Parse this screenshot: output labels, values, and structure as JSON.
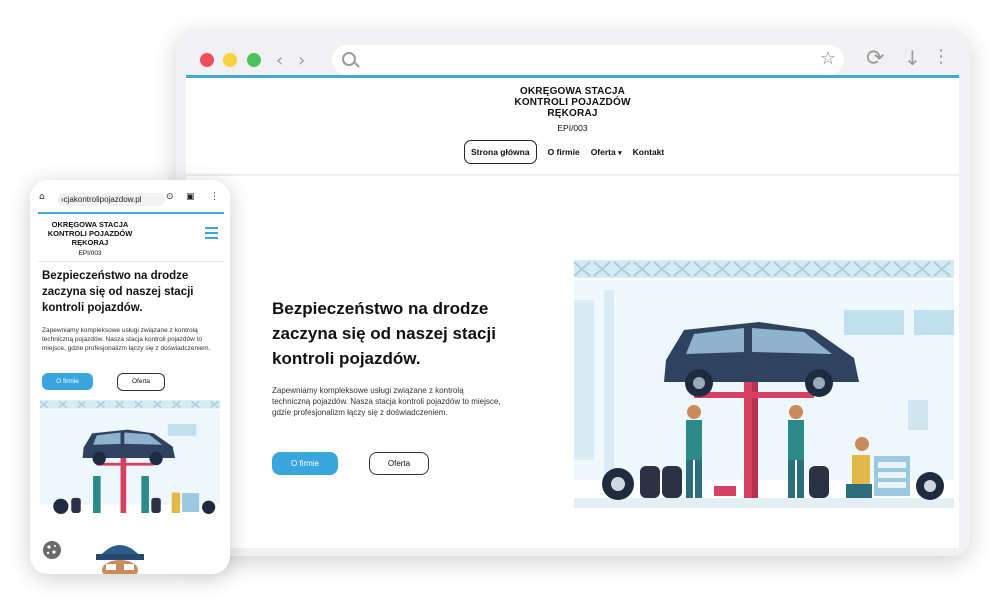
{
  "brand": {
    "line1": "OKRĘGOWA STACJA",
    "line2": "KONTROLI POJAZDÓW",
    "line3": "RĘKORAJ",
    "code": "EPI/003"
  },
  "nav": {
    "home": "Strona główna",
    "about": "O firmie",
    "offer": "Oferta",
    "contact": "Kontakt"
  },
  "hero": {
    "title": "Bezpieczeństwo na drodze zaczyna się od naszej stacji kontroli pojazdów.",
    "text": "Zapewniamy kompleksowe usługi związane z kontrolą techniczną pojazdów. Nasza stacja kontroli pojazdów to miejsce, gdzie profesjonalizm łączy się z doświadczeniem.",
    "primary_button": "O firmie",
    "secondary_button": "Oferta"
  },
  "mobile": {
    "url": "›cjakontrolipojazdow.pl"
  },
  "icons": {
    "back": "chevron-left-icon",
    "forward": "chevron-right-icon",
    "search": "search-icon",
    "bookmark": "star-icon",
    "reload": "reload-icon",
    "download": "download-icon",
    "menu": "kebab-menu-icon",
    "hamburger": "hamburger-menu-icon",
    "cookie": "cookie-icon"
  },
  "colors": {
    "accent": "#3aa6e0",
    "window_red": "#ef4f5a",
    "window_yellow": "#f6d23d",
    "window_green": "#4cc35a"
  }
}
